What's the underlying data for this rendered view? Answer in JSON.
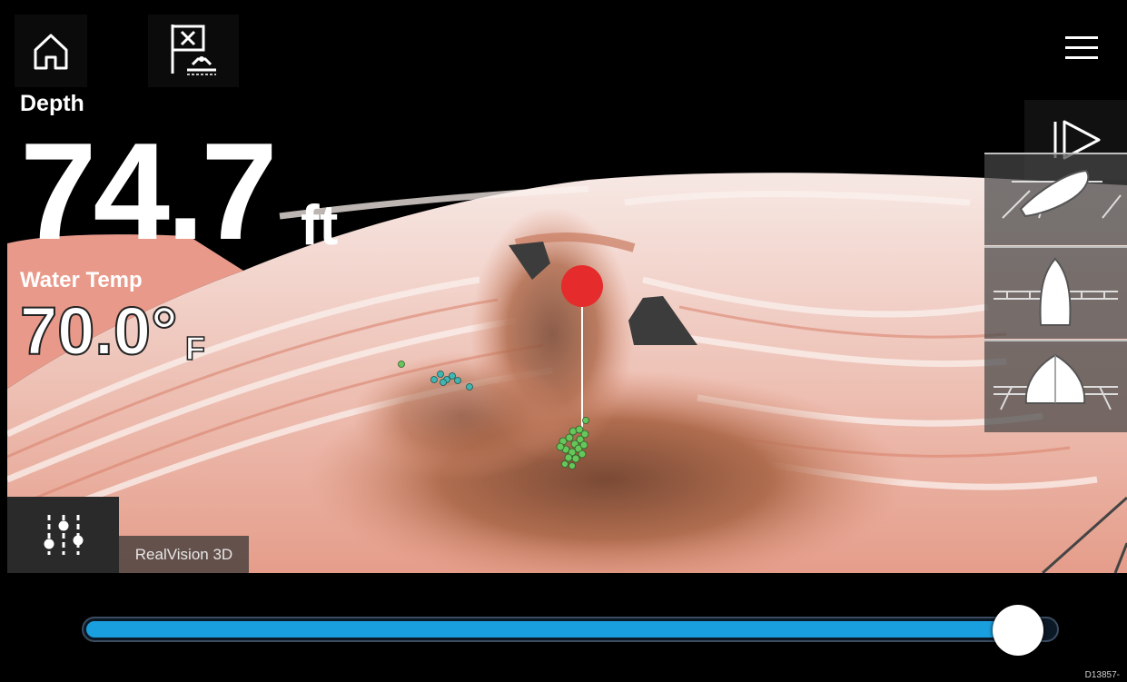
{
  "colors": {
    "accent": "#1a9fde",
    "target_marker": "#e52b2b",
    "seabed": "#e9a392",
    "fish_green": "#66c65a",
    "fish_teal": "#3fb6b2"
  },
  "toolbar": {
    "home_icon": "home-icon",
    "mob_icon": "man-overboard-icon",
    "menu_icon": "hamburger-menu-icon",
    "play_icon": "play-icon"
  },
  "readouts": {
    "depth_label": "Depth",
    "depth_value": "74.7",
    "depth_unit": "ft",
    "temp_label": "Water Temp",
    "temp_value": "70.0°",
    "temp_unit": "F"
  },
  "view_buttons": [
    "iso-view-icon",
    "top-view-icon",
    "front-view-icon"
  ],
  "mode": {
    "label": "RealVision 3D",
    "settings_icon": "settings-sliders-icon"
  },
  "history_slider": {
    "value": 0.97
  },
  "image_code": "D13857-"
}
